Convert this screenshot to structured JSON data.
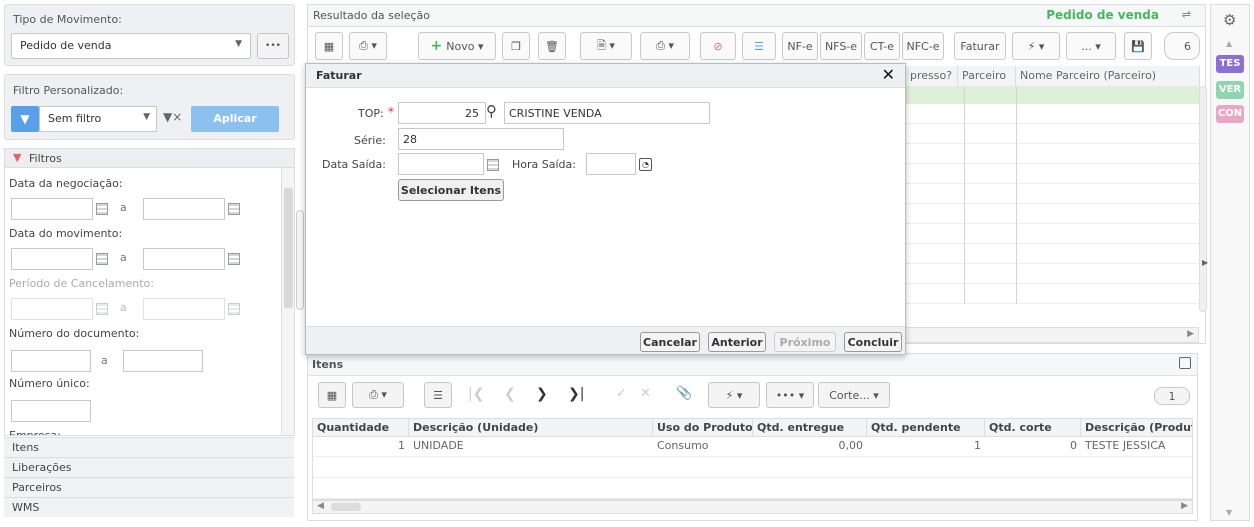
{
  "left_panel": {
    "tipo_movimento_label": "Tipo de Movimento:",
    "tipo_movimento_value": "Pedido de venda",
    "more_label": "•••",
    "filtro_label": "Filtro Personalizado:",
    "filtro_value": "Sem filtro",
    "aplicar_label": "Aplicar",
    "filtros_header": "Filtros",
    "data_negociacao": "Data da negociação:",
    "data_movimento": "Data do movimento:",
    "periodo_cancelamento": "Período de Cancelamento:",
    "numero_documento": "Número do documento:",
    "numero_unico": "Número único:",
    "empresa": "Empresa:",
    "range_sep": "a",
    "sections": [
      "Itens",
      "Liberações",
      "Parceiros",
      "WMS"
    ]
  },
  "top": {
    "result_title": "Resultado da seleção",
    "pedido_title": "Pedido de venda",
    "novo_label": "Novo",
    "nfe": "NF-e",
    "nfse": "NFS-e",
    "cte": "CT-e",
    "nfce": "NFC-e",
    "faturar": "Faturar",
    "ellipsis": "...",
    "page_num": "6",
    "columns": [
      "presso?",
      "Parceiro",
      "Nome Parceiro (Parceiro)"
    ]
  },
  "right_tags": [
    "TES",
    "VER",
    "CON"
  ],
  "dialog": {
    "title": "Faturar",
    "top_label": "TOP:",
    "top_value": "25",
    "top_desc": "CRISTINE VENDA",
    "serie_label": "Série:",
    "serie_value": "28",
    "data_saida_label": "Data Saída:",
    "hora_saida_label": "Hora Saída:",
    "selecionar_label": "Selecionar Itens",
    "cancelar": "Cancelar",
    "anterior": "Anterior",
    "proximo": "Próximo",
    "concluir": "Concluir"
  },
  "itens": {
    "title": "Itens",
    "corte_label": "Corte...",
    "page_num": "1",
    "columns": [
      "Quantidade",
      "Descrição (Unidade)",
      "Uso do Produto",
      "Qtd. entregue",
      "Qtd. pendente",
      "Qtd. corte",
      "Descrição (Produto)"
    ],
    "row": [
      "1",
      "UNIDADE",
      "Consumo",
      "0,00",
      "1",
      "0",
      "TESTE JESSICA"
    ]
  },
  "colors": {
    "accent_blue": "#5aa0e6",
    "green_title": "#46b85a",
    "tag_tes": "#8b6fd6",
    "tag_ver": "#8fd6b0",
    "tag_con": "#e8a7c4"
  }
}
